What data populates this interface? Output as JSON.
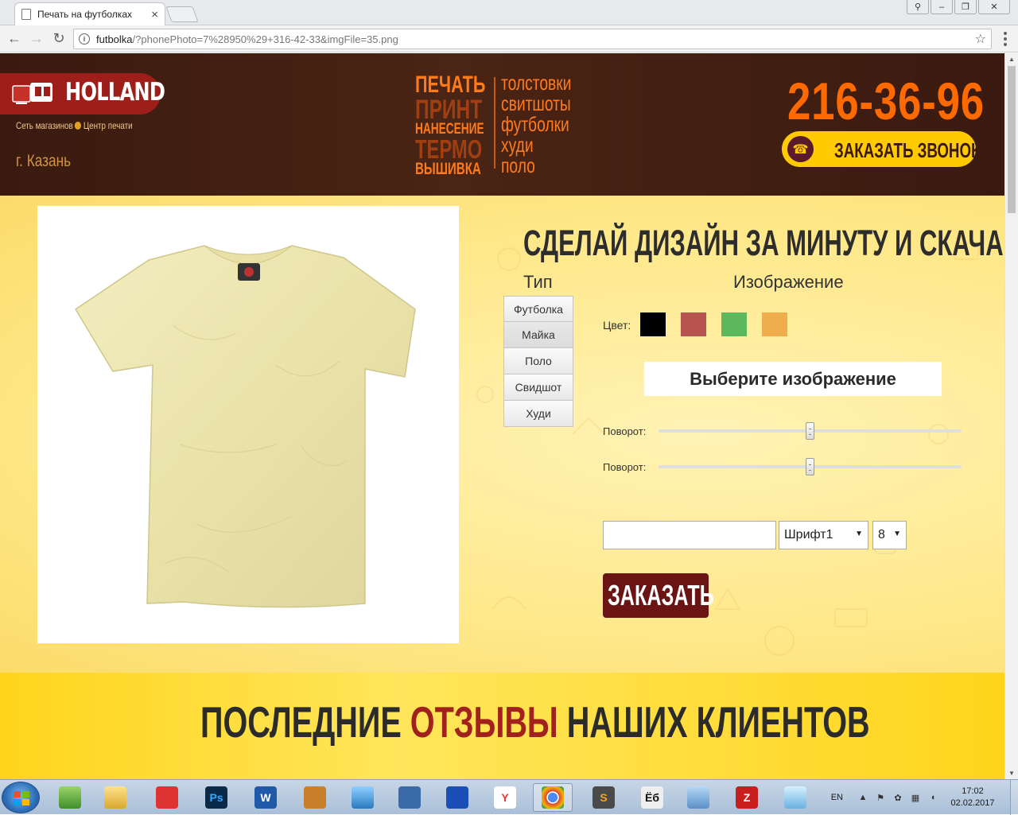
{
  "browser": {
    "tab_title": "Печать на футболках",
    "tab_close": "×",
    "url_host": "futbolka",
    "url_rest": "/?phonePhoto=7%28950%29+316-42-33&imgFile=35.png",
    "back": "←",
    "forward": "→",
    "reload": "↻",
    "star": "☆",
    "info": "i",
    "win_min": "–",
    "win_max": "❐",
    "win_close": "✕",
    "win_user": "⚲"
  },
  "header": {
    "logo_text": "HOLLAND",
    "logo_sub_left": "Сеть магазинов",
    "logo_sub_right": "Центр печати",
    "city": "г. Казань",
    "services_left": [
      "ПЕЧАТЬ",
      "ПРИНТ",
      "НАНЕСЕНИЕ",
      "ТЕРМО",
      "ВЫШИВКА"
    ],
    "services_right": [
      "толстовки",
      "свитшоты",
      "футболки",
      "худи",
      "поло"
    ],
    "phone": "216-36-96",
    "call_button": "ЗАКАЗАТЬ ЗВОНОК!",
    "call_icon": "☎",
    "colors": {
      "brand_red": "#9e1f1a",
      "orange": "#ff6a00",
      "yellow": "#ffcb00",
      "dark_brown": "#3a1a0f"
    }
  },
  "designer": {
    "title": "СДЕЛАЙ ДИЗАЙН ЗА МИНУТУ И СКАЧАЙ",
    "type_label": "Тип",
    "image_label": "Изображение",
    "types": [
      "Футболка",
      "Майка",
      "Поло",
      "Свидшот",
      "Худи"
    ],
    "active_type": "Майка",
    "color_label": "Цвет:",
    "colors": [
      "#000000",
      "#b85450",
      "#5cb85c",
      "#f0ad4e"
    ],
    "choose_image": "Выберите изображение",
    "rotation1_label": "Поворот:",
    "rotation2_label": "Поворот:",
    "rotation1_value": 0.5,
    "rotation2_value": 0.5,
    "text_value": "",
    "font_select": "Шрифт1",
    "size_select": "8",
    "order_button": "ЗАКАЗАТЬ",
    "tshirt_color": "#efe9b8"
  },
  "reviews": {
    "title_part1": "ПОСЛЕДНИЕ ",
    "title_accent": "ОТЗЫВЫ",
    "title_part2": " НАШИХ КЛИЕНТОВ",
    "accent_color": "#a1221c"
  },
  "taskbar": {
    "apps": [
      {
        "name": "notepad-app",
        "icon": "notepad-icon"
      },
      {
        "name": "explorer-app",
        "icon": "folder-icon"
      },
      {
        "name": "network-app",
        "icon": "network-icon"
      },
      {
        "name": "photoshop-app",
        "icon": "photoshop-icon",
        "label": "Ps"
      },
      {
        "name": "word-app",
        "icon": "word-icon",
        "label": "W"
      },
      {
        "name": "contacts-app",
        "icon": "contacts-icon"
      },
      {
        "name": "image-viewer-app",
        "icon": "image-icon"
      },
      {
        "name": "network-map-app",
        "icon": "network-map-icon"
      },
      {
        "name": "bluetooth-app",
        "icon": "bluetooth-icon"
      },
      {
        "name": "yandex-app",
        "icon": "yandex-icon",
        "label": "Y"
      },
      {
        "name": "chrome-app",
        "icon": "chrome-icon"
      },
      {
        "name": "sublime-app",
        "icon": "sublime-icon",
        "label": "S"
      },
      {
        "name": "yo-app",
        "icon": "yo-icon",
        "label": "Ёб"
      },
      {
        "name": "screenshot-app",
        "icon": "screenshot-icon"
      },
      {
        "name": "filezilla-app",
        "icon": "filezilla-icon",
        "label": "Z"
      },
      {
        "name": "eraser-app",
        "icon": "eraser-icon"
      }
    ],
    "lang": "EN",
    "time": "17:02",
    "date": "02.02.2017"
  }
}
